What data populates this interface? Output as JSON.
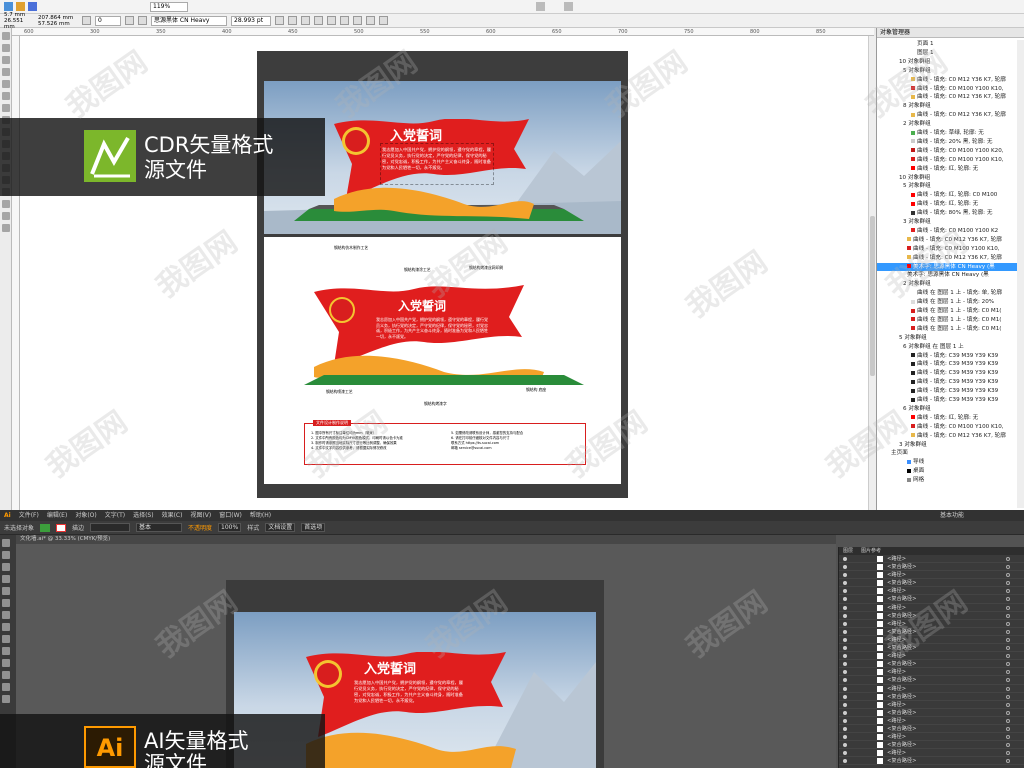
{
  "cdr": {
    "zoom": "119%",
    "pos_x": "5.7 mm",
    "pos_y": "26.551 mm",
    "width": "207.864 mm",
    "height": "57.526 mm",
    "angle": "0",
    "font_name": "思源黑体 CN Heavy",
    "font_size": "28.993 pt",
    "ruler_ticks": [
      "600",
      "300",
      "350",
      "400",
      "450",
      "500",
      "550",
      "600",
      "650",
      "700",
      "750",
      "800",
      "850"
    ],
    "objmgr_title": "对象管理器",
    "objmgr_rows": [
      {
        "text": "页面 1",
        "indent": 40,
        "color": ""
      },
      {
        "text": "图层 1",
        "indent": 40,
        "color": ""
      },
      {
        "text": "10 对象群组",
        "indent": 22,
        "color": ""
      },
      {
        "text": "5 对象群组",
        "indent": 26,
        "color": ""
      },
      {
        "text": "曲线 - 填充: C0 M12 Y36 K7, 轮廓",
        "indent": 34,
        "color": "#e8b84a"
      },
      {
        "text": "曲线 - 填充: C0 M100 Y100 K10,",
        "indent": 34,
        "color": "#d81e1e"
      },
      {
        "text": "曲线 - 填充: C0 M12 Y36 K7, 轮廓",
        "indent": 34,
        "color": "#e8b84a"
      },
      {
        "text": "8 对象群组",
        "indent": 26,
        "color": ""
      },
      {
        "text": "曲线 - 填充: C0 M12 Y36 K7, 轮廓",
        "indent": 34,
        "color": "#e8b84a"
      },
      {
        "text": "2 对象群组",
        "indent": 26,
        "color": ""
      },
      {
        "text": "曲线 - 填充: 草绿, 轮廓: 无",
        "indent": 34,
        "color": "#4caf50"
      },
      {
        "text": "曲线 - 填充: 20% 黑, 轮廓: 无",
        "indent": 34,
        "color": "#ccc"
      },
      {
        "text": "曲线 - 填充: C0 M100 Y100 K20,",
        "indent": 34,
        "color": "#c01818"
      },
      {
        "text": "曲线 - 填充: C0 M100 Y100 K10,",
        "indent": 34,
        "color": "#d81e1e"
      },
      {
        "text": "曲线 - 填充: 红, 轮廓: 无",
        "indent": 34,
        "color": "#ff0000"
      },
      {
        "text": "10 对象群组",
        "indent": 22,
        "color": ""
      },
      {
        "text": "5 对象群组",
        "indent": 26,
        "color": ""
      },
      {
        "text": "曲线 - 填充: 红, 轮廓: C0 M100",
        "indent": 34,
        "color": "#ff0000"
      },
      {
        "text": "曲线 - 填充: 红, 轮廓: 无",
        "indent": 34,
        "color": "#ff0000"
      },
      {
        "text": "曲线 - 填充: 80% 黑, 轮廓: 无",
        "indent": 34,
        "color": "#333"
      },
      {
        "text": "3 对象群组",
        "indent": 26,
        "color": ""
      },
      {
        "text": "曲线 - 填充: C0 M100 Y100 K2",
        "indent": 34,
        "color": "#e21e1e"
      },
      {
        "text": "曲线 - 填充: C0 M12 Y36 K7, 轮廓",
        "indent": 30,
        "color": "#e8b84a"
      },
      {
        "text": "曲线 - 填充: C0 M100 Y100 K10,",
        "indent": 30,
        "color": "#d81e1e"
      },
      {
        "text": "曲线 - 填充: C0 M12 Y36 K7, 轮廓",
        "indent": 30,
        "color": "#e8b84a"
      },
      {
        "text": "美术字: 思源黑体 CN Heavy (黑",
        "indent": 30,
        "color": "#ff0000",
        "selected": true
      },
      {
        "text": "美术字: 思源黑体 CN Heavy (黑",
        "indent": 30,
        "color": ""
      },
      {
        "text": "2 对象群组",
        "indent": 26,
        "color": ""
      },
      {
        "text": "曲线 在 图层 1 上 - 填充: 单, 轮廓",
        "indent": 34,
        "color": "#fff"
      },
      {
        "text": "曲线 在 图层 1 上 - 填充: 20%",
        "indent": 34,
        "color": "#ddd"
      },
      {
        "text": "曲线 在 图层 1 上 - 填充: C0 M1(",
        "indent": 34,
        "color": "#d81e1e"
      },
      {
        "text": "曲线 在 图层 1 上 - 填充: C0 M1(",
        "indent": 34,
        "color": "#d81e1e"
      },
      {
        "text": "曲线 在 图层 1 上 - 填充: C0 M1(",
        "indent": 34,
        "color": "#d81e1e"
      },
      {
        "text": "5 对象群组",
        "indent": 22,
        "color": ""
      },
      {
        "text": "6 对象群组 在 图层 1 上",
        "indent": 26,
        "color": ""
      },
      {
        "text": "曲线 - 填充: C39 M39 Y39 K39",
        "indent": 34,
        "color": "#222"
      },
      {
        "text": "曲线 - 填充: C39 M39 Y39 K39",
        "indent": 34,
        "color": "#222"
      },
      {
        "text": "曲线 - 填充: C39 M39 Y39 K39",
        "indent": 34,
        "color": "#222"
      },
      {
        "text": "曲线 - 填充: C39 M39 Y39 K39",
        "indent": 34,
        "color": "#222"
      },
      {
        "text": "曲线 - 填充: C39 M39 Y39 K39",
        "indent": 34,
        "color": "#222"
      },
      {
        "text": "曲线 - 填充: C39 M39 Y39 K39",
        "indent": 34,
        "color": "#222"
      },
      {
        "text": "6 对象群组",
        "indent": 26,
        "color": ""
      },
      {
        "text": "曲线 - 填充: 红, 轮廓: 无",
        "indent": 34,
        "color": "#ff0000"
      },
      {
        "text": "曲线 - 填充: C0 M100 Y100 K10,",
        "indent": 34,
        "color": "#d81e1e"
      },
      {
        "text": "曲线 - 填充: C0 M12 Y36 K7, 轮廓",
        "indent": 34,
        "color": "#e8b84a"
      },
      {
        "text": "3 对象群组",
        "indent": 22,
        "color": ""
      },
      {
        "text": "主页面",
        "indent": 14,
        "color": ""
      },
      {
        "text": "导线",
        "indent": 30,
        "color": "#3b8fff"
      },
      {
        "text": "桌面",
        "indent": 30,
        "color": "#000"
      },
      {
        "text": "网格",
        "indent": 30,
        "color": "#888"
      }
    ]
  },
  "artwork": {
    "title": "入党誓词",
    "pledge": "我志愿加入中国共产党，拥护党的纲领，遵守党的章程，履行党员义务，执行党的决定，严守党的纪律，保守党的秘密，对党忠诚，积极工作，为共产主义奋斗终身，随时准备为党和人民牺牲一切，永不叛党。",
    "labels_top": [
      "钢结构仿木制作工艺",
      "钢结构漆涂工艺",
      "钢结构烤漆丝网印刷"
    ],
    "labels_bottom": [
      "钢结构喷漆工艺",
      "钢结构烤漆字",
      "钢结构 底座"
    ],
    "notes_title": "文件设计制作说明",
    "notes_left": [
      "1. 图中所有尺寸标注单位均为mm（毫米）",
      "2. 文件中所有颜色均为CMYK颜色模式，印刷时请以色卡为准",
      "3. 制作时请参照当地实际尺寸进行等比例调整，确保效果",
      "4. 文件中文字内容仅供参考，请根据实际情况修改"
    ],
    "notes_right": [
      "5. 如需修改请联系设计师，感谢您的支持与配合",
      "6. 请在打印前仔细核对文件内容与尺寸",
      "联系方式 https://ts.sucai.com",
      "邮箱 service@sucai.com"
    ]
  },
  "ai": {
    "menu": [
      "Ai",
      "文件(F)",
      "编辑(E)",
      "对象(O)",
      "文字(T)",
      "选择(S)",
      "效果(C)",
      "视图(V)",
      "窗口(W)",
      "帮助(H)"
    ],
    "workspace": "基本功能",
    "ctrl": {
      "mode": "未选择对象",
      "stroke_label": "描边",
      "stroke_value": "",
      "style_label": "基本",
      "opacity_label": "不透明度",
      "opacity_value": "100%",
      "style2": "样式",
      "doc_setup": "文档设置",
      "prefs": "首选项"
    },
    "doc_tab": "文化墙.ai* @ 33.33% (CMYK/预览)",
    "panel_tabs": [
      "图层",
      "图片参考"
    ],
    "layer_rows": [
      "<路径>",
      "<复合路径>",
      "<路径>",
      "<复合路径>",
      "<路径>",
      "<复合路径>",
      "<路径>",
      "<复合路径>",
      "<路径>",
      "<复合路径>",
      "<路径>",
      "<复合路径>",
      "<路径>",
      "<复合路径>",
      "<路径>",
      "<复合路径>",
      "<路径>",
      "<复合路径>",
      "<路径>",
      "<复合路径>",
      "<路径>",
      "<复合路径>",
      "<路径>",
      "<复合路径>",
      "<路径>",
      "<复合路径>"
    ]
  },
  "badges": {
    "cdr_line1": "CDR矢量格式",
    "cdr_line2": "源文件",
    "ai_line1": "AI矢量格式",
    "ai_line2": "源文件"
  },
  "watermark": "我图网"
}
